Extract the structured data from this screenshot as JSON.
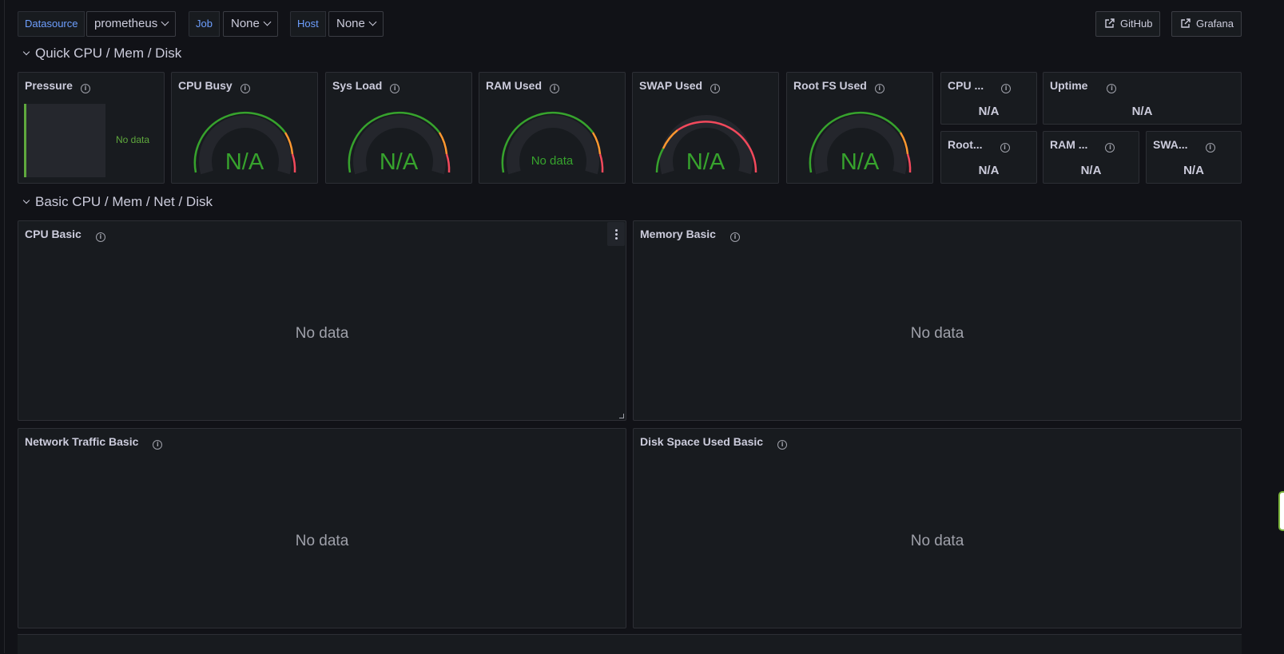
{
  "variables": {
    "datasource": {
      "label": "Datasource",
      "value": "prometheus"
    },
    "job": {
      "label": "Job",
      "value": "None"
    },
    "host": {
      "label": "Host",
      "value": "None"
    }
  },
  "links": {
    "github": "GitHub",
    "grafana": "Grafana"
  },
  "rows": {
    "quick": "Quick CPU / Mem / Disk",
    "basic": "Basic CPU / Mem / Net / Disk"
  },
  "panels": {
    "pressure": {
      "title": "Pressure",
      "value": "No data"
    },
    "cpu_busy": {
      "title": "CPU Busy",
      "value": "N/A"
    },
    "sys_load": {
      "title": "Sys Load",
      "value": "N/A"
    },
    "ram_used": {
      "title": "RAM Used",
      "value": "No data"
    },
    "swap_used": {
      "title": "SWAP Used",
      "value": "N/A"
    },
    "rootfs_used": {
      "title": "Root FS Used",
      "value": "N/A"
    },
    "cpu_cores": {
      "title": "CPU ...",
      "value": "N/A"
    },
    "uptime": {
      "title": "Uptime",
      "value": "N/A"
    },
    "rootfs_total": {
      "title": "Root...",
      "value": "N/A"
    },
    "ram_total": {
      "title": "RAM ...",
      "value": "N/A"
    },
    "swap_total": {
      "title": "SWA...",
      "value": "N/A"
    },
    "cpu_basic": {
      "title": "CPU Basic",
      "value": "No data"
    },
    "memory_basic": {
      "title": "Memory Basic",
      "value": "No data"
    },
    "network_basic": {
      "title": "Network Traffic Basic",
      "value": "No data"
    },
    "disk_basic": {
      "title": "Disk Space Used Basic",
      "value": "No data"
    }
  },
  "icons": {
    "info": "info-icon",
    "external_link": "external-link-icon",
    "chevron": "chevron-down-icon",
    "menu": "kebab-menu-icon"
  },
  "colors": {
    "background": "#111217",
    "panel": "#181b1f",
    "variable_label": "#6e9fff",
    "value_green": "#37a32d",
    "threshold_green": "#37a32d",
    "threshold_orange": "#ff9830",
    "threshold_red": "#f2495c"
  }
}
